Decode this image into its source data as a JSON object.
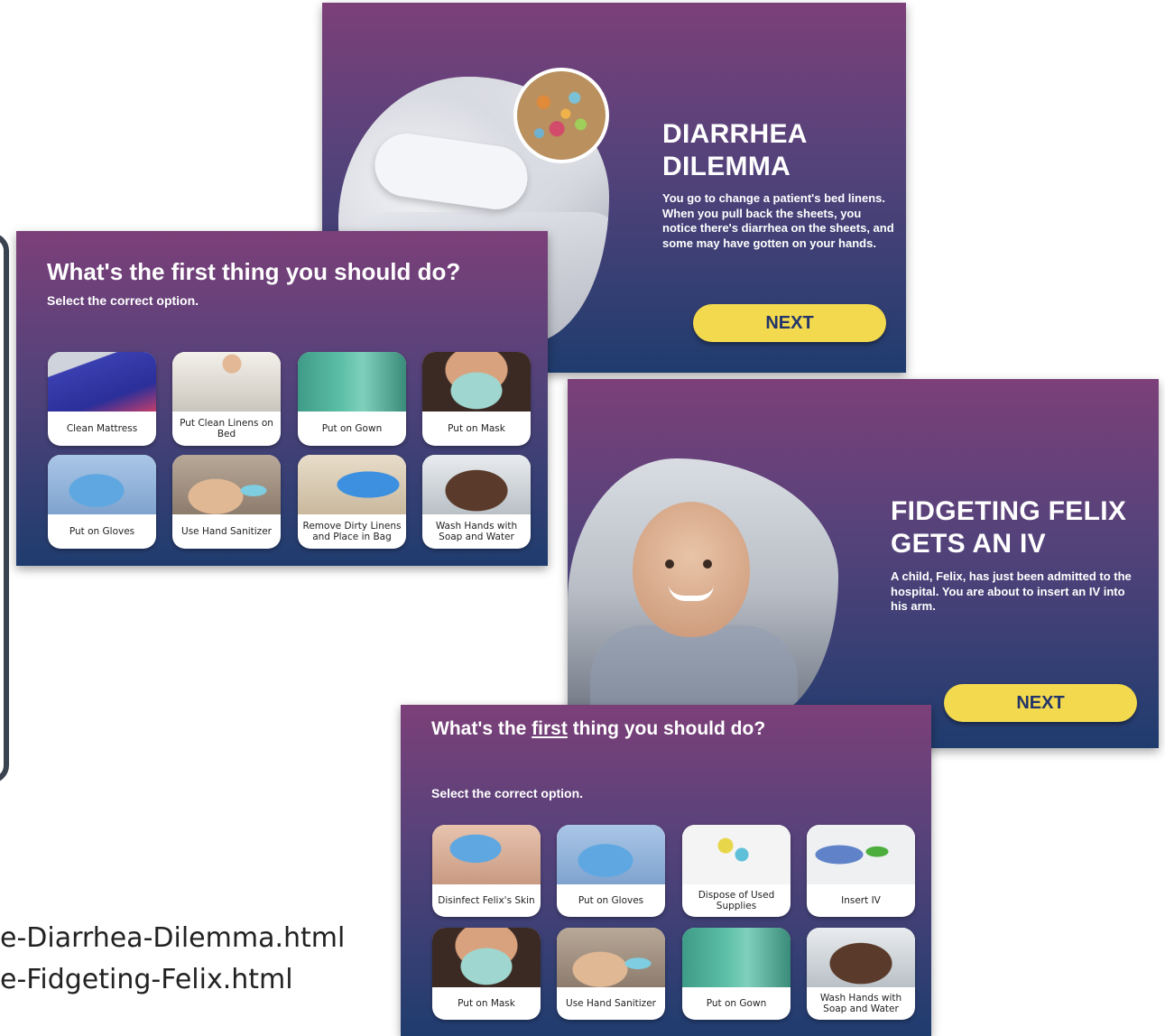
{
  "captions": [
    "e-Diarrhea-Dilemma.html",
    "e-Fidgeting-Felix.html"
  ],
  "diarrhea_intro": {
    "title": "DIARRHEA DILEMMA",
    "text": "You go to change a patient's bed linens. When you pull back the sheets, you notice there's diarrhea on the sheets, and some may have gotten on your hands.",
    "next_label": "NEXT"
  },
  "diarrhea_question": {
    "title": "What's the first thing you should do?",
    "subtitle": "Select the correct option.",
    "options": [
      {
        "label": "Clean Mattress",
        "icon": "mattress-photo"
      },
      {
        "label": "Put Clean Linens on Bed",
        "icon": "linens-photo"
      },
      {
        "label": "Put on Gown",
        "icon": "gown-photo"
      },
      {
        "label": "Put on Mask",
        "icon": "mask-photo"
      },
      {
        "label": "Put on Gloves",
        "icon": "gloves-photo"
      },
      {
        "label": "Use Hand Sanitizer",
        "icon": "sanitizer-photo"
      },
      {
        "label": "Remove Dirty Linens and Place in Bag",
        "icon": "linen-bag-photo"
      },
      {
        "label": "Wash Hands with Soap and Water",
        "icon": "handwash-photo"
      }
    ]
  },
  "felix_intro": {
    "title": "FIDGETING FELIX GETS AN IV",
    "text": "A child, Felix, has just been admitted to the hospital. You are about to insert an IV into his arm.",
    "next_label": "NEXT"
  },
  "felix_question": {
    "title_pre": "What's the ",
    "title_emph": "first",
    "title_post": " thing you should do?",
    "subtitle": "Select the correct option.",
    "options": [
      {
        "label": "Disinfect Felix's Skin",
        "icon": "disinfect-photo"
      },
      {
        "label": "Put on Gloves",
        "icon": "gloves-photo"
      },
      {
        "label": "Dispose of Used Supplies",
        "icon": "supplies-photo"
      },
      {
        "label": "Insert IV",
        "icon": "iv-photo"
      },
      {
        "label": "Put on Mask",
        "icon": "mask-photo"
      },
      {
        "label": "Use Hand Sanitizer",
        "icon": "sanitizer-photo"
      },
      {
        "label": "Put on Gown",
        "icon": "gown-photo"
      },
      {
        "label": "Wash Hands with Soap and Water",
        "icon": "handwash-photo"
      }
    ]
  },
  "colors": {
    "gradient_top": "#7c4079",
    "gradient_bottom": "#1f3c6e",
    "next_button": "#f2d94e",
    "next_text": "#22346a"
  }
}
